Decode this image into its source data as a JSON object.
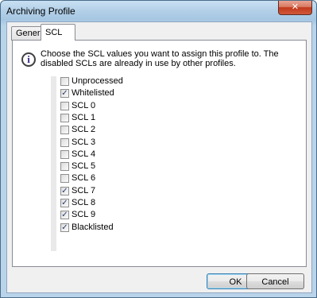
{
  "window": {
    "title": "Archiving Profile",
    "close_glyph": "✕"
  },
  "tabs": [
    {
      "label": "General",
      "active": false
    },
    {
      "label": "SCL",
      "active": true
    }
  ],
  "info": {
    "icon": "info-icon",
    "icon_glyph": "i",
    "text": "Choose the SCL values you want to assign this profile to. The disabled SCLs are already in use by other profiles."
  },
  "scl_list": [
    {
      "label": "Unprocessed",
      "checked": false
    },
    {
      "label": "Whitelisted",
      "checked": true
    },
    {
      "label": "SCL 0",
      "checked": false
    },
    {
      "label": "SCL 1",
      "checked": false
    },
    {
      "label": "SCL 2",
      "checked": false
    },
    {
      "label": "SCL 3",
      "checked": false
    },
    {
      "label": "SCL 4",
      "checked": false
    },
    {
      "label": "SCL 5",
      "checked": false
    },
    {
      "label": "SCL 6",
      "checked": false
    },
    {
      "label": "SCL 7",
      "checked": true
    },
    {
      "label": "SCL 8",
      "checked": true
    },
    {
      "label": "SCL 9",
      "checked": true
    },
    {
      "label": "Blacklisted",
      "checked": true
    }
  ],
  "buttons": {
    "ok": "OK",
    "cancel": "Cancel"
  },
  "check_glyph": "✓"
}
